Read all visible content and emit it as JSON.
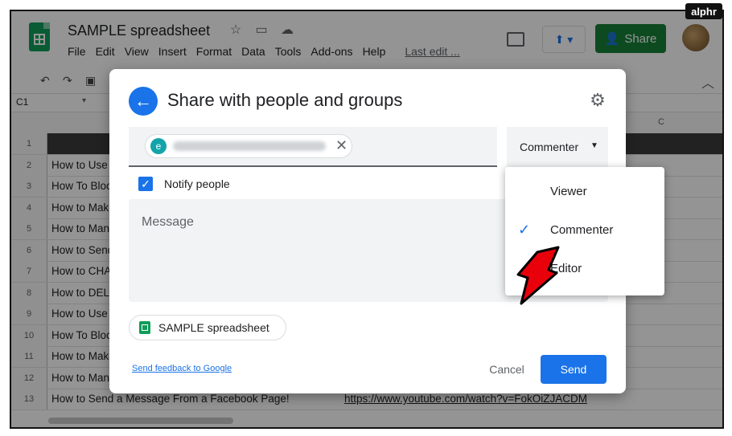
{
  "app": {
    "doc_title": "SAMPLE spreadsheet",
    "menu": [
      "File",
      "Edit",
      "View",
      "Insert",
      "Format",
      "Data",
      "Tools",
      "Add-ons",
      "Help"
    ],
    "last_edit": "Last edit ...",
    "share_label": "Share",
    "name_box": "C1",
    "column_header": "C"
  },
  "sheet": {
    "rows": [
      {
        "n": "1",
        "a": "",
        "b": ""
      },
      {
        "n": "2",
        "a": "How to Use",
        "b": ""
      },
      {
        "n": "3",
        "a": "How To Bloc",
        "b": ""
      },
      {
        "n": "4",
        "a": "How to Make",
        "b": ""
      },
      {
        "n": "5",
        "a": "How to Mana",
        "b": ""
      },
      {
        "n": "6",
        "a": "How to Send",
        "b": ""
      },
      {
        "n": "7",
        "a": "How to CHA",
        "b": ""
      },
      {
        "n": "8",
        "a": "How to DEL",
        "b": ""
      },
      {
        "n": "9",
        "a": "How to Use",
        "b": ""
      },
      {
        "n": "10",
        "a": "How To Bloc",
        "b": ""
      },
      {
        "n": "11",
        "a": "How to Make",
        "b": ""
      },
      {
        "n": "12",
        "a": "How to Mana",
        "b": ""
      },
      {
        "n": "13",
        "a": "How to Send a Message From a Facebook Page!",
        "b": "https://www.youtube.com/watch?v=FokOiZJACDM"
      }
    ]
  },
  "dialog": {
    "title": "Share with people and groups",
    "chip_initial": "e",
    "role": "Commenter",
    "notify_label": "Notify people",
    "message_placeholder": "Message",
    "file_name": "SAMPLE spreadsheet",
    "feedback_link": "Send feedback to Google",
    "cancel_label": "Cancel",
    "send_label": "Send"
  },
  "role_menu": {
    "items": [
      "Viewer",
      "Commenter",
      "Editor"
    ],
    "selected": "Commenter"
  },
  "watermark": "alphr"
}
